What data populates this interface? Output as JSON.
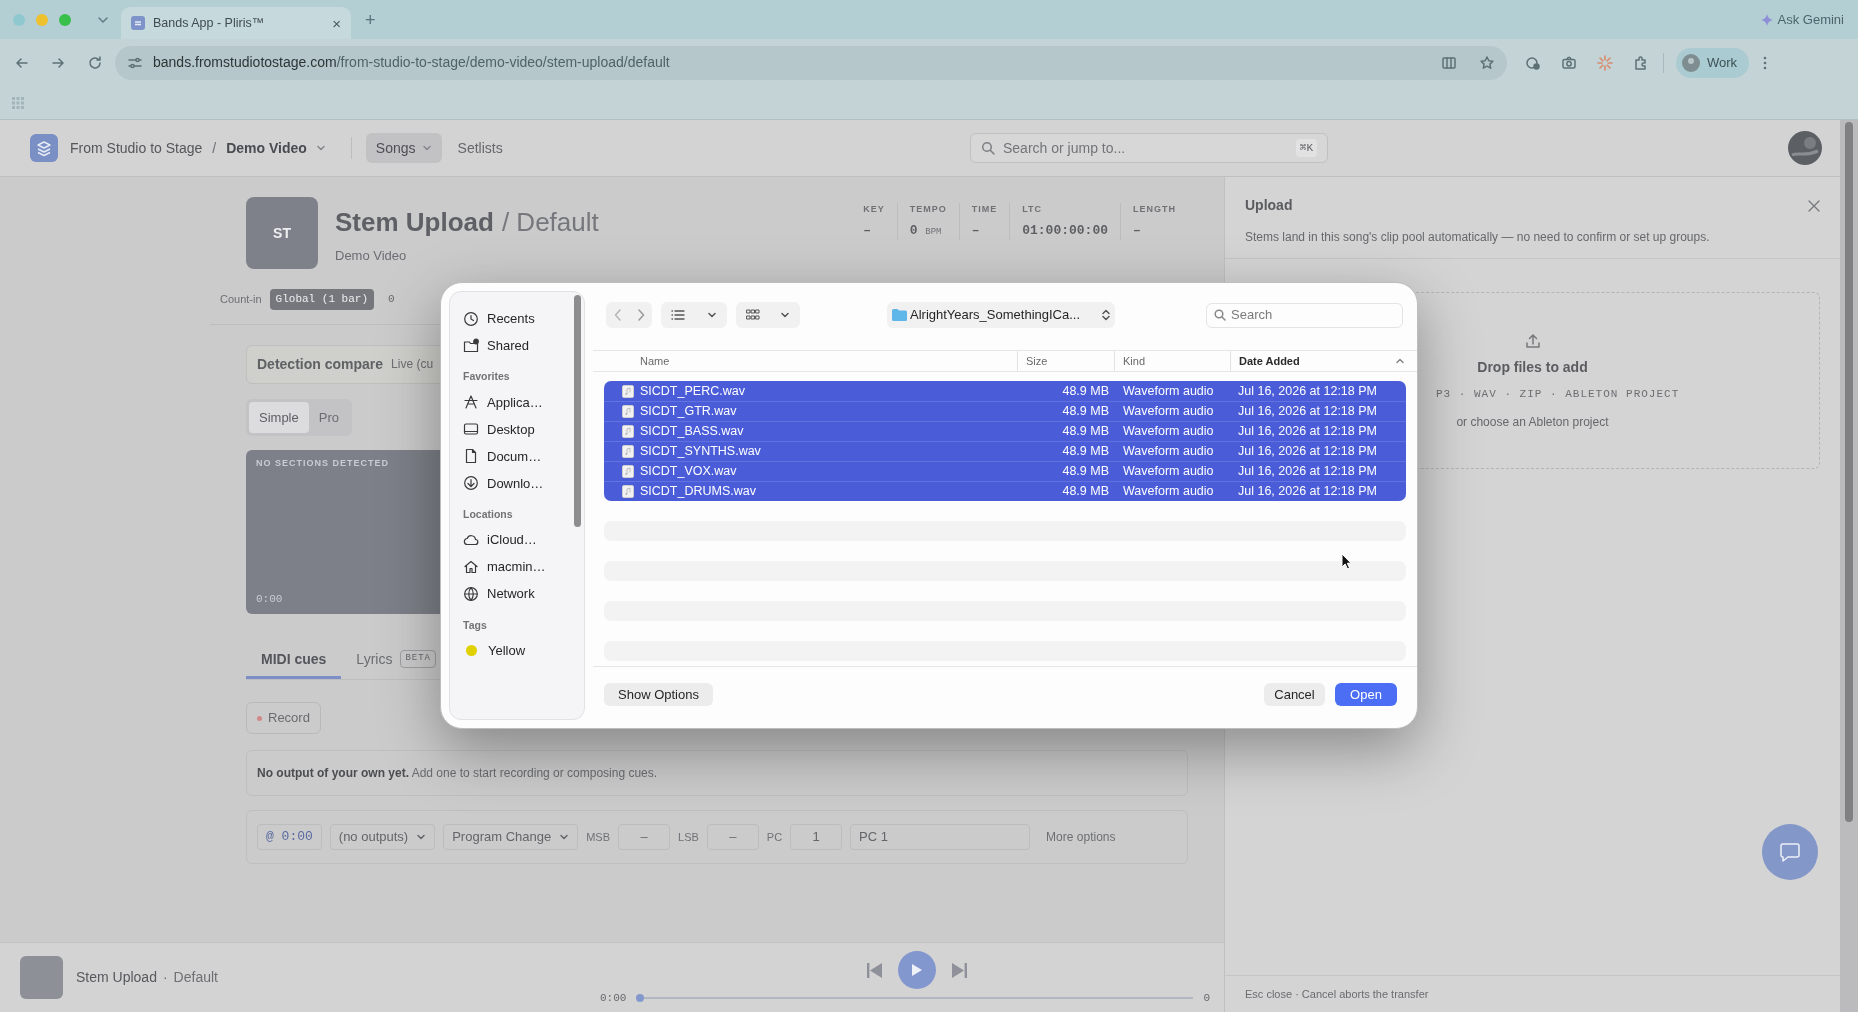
{
  "browser": {
    "tab": {
      "title": "Bands App - Pliris™",
      "close": "×"
    },
    "new_tab": "+",
    "ask_gemini": "Ask Gemini",
    "url": {
      "host": "bands.fromstudiotostage.com",
      "path": "/from-studio-to-stage/demo-video/stem-upload/default"
    },
    "profile": "Work"
  },
  "app_header": {
    "breadcrumb": [
      "From Studio to Stage",
      "Demo Video"
    ],
    "separator": "/",
    "nav": [
      {
        "label": "Songs",
        "selected": true
      },
      {
        "label": "Setlists",
        "selected": false
      }
    ],
    "search": {
      "placeholder": "Search or jump to...",
      "shortcut": "⌘K"
    }
  },
  "song": {
    "tile": "ST",
    "title": "Stem Upload",
    "variant": "/ Default",
    "subtitle": "Demo Video",
    "meta": [
      {
        "label": "KEY",
        "value": "–"
      },
      {
        "label": "TEMPO",
        "value": "0",
        "unit": "BPM"
      },
      {
        "label": "TIME",
        "value": "–"
      },
      {
        "label": "LTC",
        "value": "01:00:00:00"
      },
      {
        "label": "LENGTH",
        "value": "–"
      }
    ]
  },
  "count_in": {
    "label": "Count-in",
    "options": [
      {
        "label": "Global (1 bar)",
        "selected": true
      },
      {
        "label": "0",
        "selected": false
      }
    ]
  },
  "detection": {
    "title": "Detection compare",
    "note": "Live (cu"
  },
  "mode_toggle": [
    {
      "label": "Simple",
      "selected": true
    },
    {
      "label": "Pro",
      "selected": false
    }
  ],
  "sections_panel": {
    "caption": "NO SECTIONS DETECTED",
    "time": "0:00"
  },
  "tabs": [
    {
      "label": "MIDI cues",
      "selected": true
    },
    {
      "label": "Lyrics",
      "badge": "BETA",
      "selected": false
    }
  ],
  "record_button": "Record",
  "notice": "**No output of your own yet.** Add one to start recording or composing cues.",
  "cue_row": {
    "time": "@ 0:00",
    "output": "(no outputs)",
    "message": "Program Change",
    "msb_label": "MSB",
    "msb": {
      "placeholder": "–"
    },
    "lsb_label": "LSB",
    "lsb": {
      "placeholder": "–"
    },
    "pc_label": "PC",
    "pc": "1",
    "name": "PC 1",
    "more": "More options"
  },
  "upload_panel": {
    "title": "Upload",
    "description": "Stems land in this song's clip pool automatically — no need to confirm or set up groups.",
    "drop": {
      "title": "Drop files to add",
      "formats": "P3 · WAV · ZIP · ABLETON PROJECT",
      "alt": "or choose an Ableton project"
    },
    "footer": "Esc close · Cancel aborts the transfer"
  },
  "player": {
    "title": "Stem Upload",
    "separator": "·",
    "variant": "Default",
    "time": "0:00",
    "end": "0",
    "level": 0
  },
  "file_dialog": {
    "sidebar": [
      {
        "items": [
          {
            "label": "Recents"
          },
          {
            "label": "Shared"
          }
        ]
      },
      {
        "heading": "Favorites",
        "items": [
          {
            "label": "Applica…"
          },
          {
            "label": "Desktop"
          },
          {
            "label": "Docum…"
          },
          {
            "label": "Downlo…"
          }
        ]
      },
      {
        "heading": "Locations",
        "items": [
          {
            "label": "iCloud…"
          },
          {
            "label": "macmin…"
          },
          {
            "label": "Network"
          }
        ]
      },
      {
        "heading": "Tags",
        "items": [
          {
            "label": "Yellow",
            "color": "#e0d000"
          }
        ]
      }
    ],
    "location": "AlrightYears_SomethingICa...",
    "search": {
      "placeholder": "Search"
    },
    "columns": [
      {
        "label": "Name",
        "sorted": false
      },
      {
        "label": "Size",
        "sorted": false
      },
      {
        "label": "Kind",
        "sorted": false
      },
      {
        "label": "Date Added",
        "sorted": true
      }
    ],
    "files": [
      {
        "name": "SICDT_PERC.wav",
        "size": "48.9 MB",
        "kind_label": "Waveform audio",
        "date": "Jul 16, 2026 at 12:18 PM",
        "selected": true
      },
      {
        "name": "SICDT_GTR.wav",
        "size": "48.9 MB",
        "kind_label": "Waveform audio",
        "date": "Jul 16, 2026 at 12:18 PM",
        "selected": true
      },
      {
        "name": "SICDT_BASS.wav",
        "size": "48.9 MB",
        "kind_label": "Waveform audio",
        "date": "Jul 16, 2026 at 12:18 PM",
        "selected": true
      },
      {
        "name": "SICDT_SYNTHS.wav",
        "size": "48.9 MB",
        "kind_label": "Waveform audio",
        "date": "Jul 16, 2026 at 12:18 PM",
        "selected": true
      },
      {
        "name": "SICDT_VOX.wav",
        "size": "48.9 MB",
        "kind_label": "Waveform audio",
        "date": "Jul 16, 2026 at 12:18 PM",
        "selected": true
      },
      {
        "name": "SICDT_DRUMS.wav",
        "size": "48.9 MB",
        "kind_label": "Waveform audio",
        "date": "Jul 16, 2026 at 12:18 PM",
        "selected": true
      }
    ],
    "buttons": {
      "options": "Show Options",
      "cancel": "Cancel",
      "open": "Open"
    }
  }
}
